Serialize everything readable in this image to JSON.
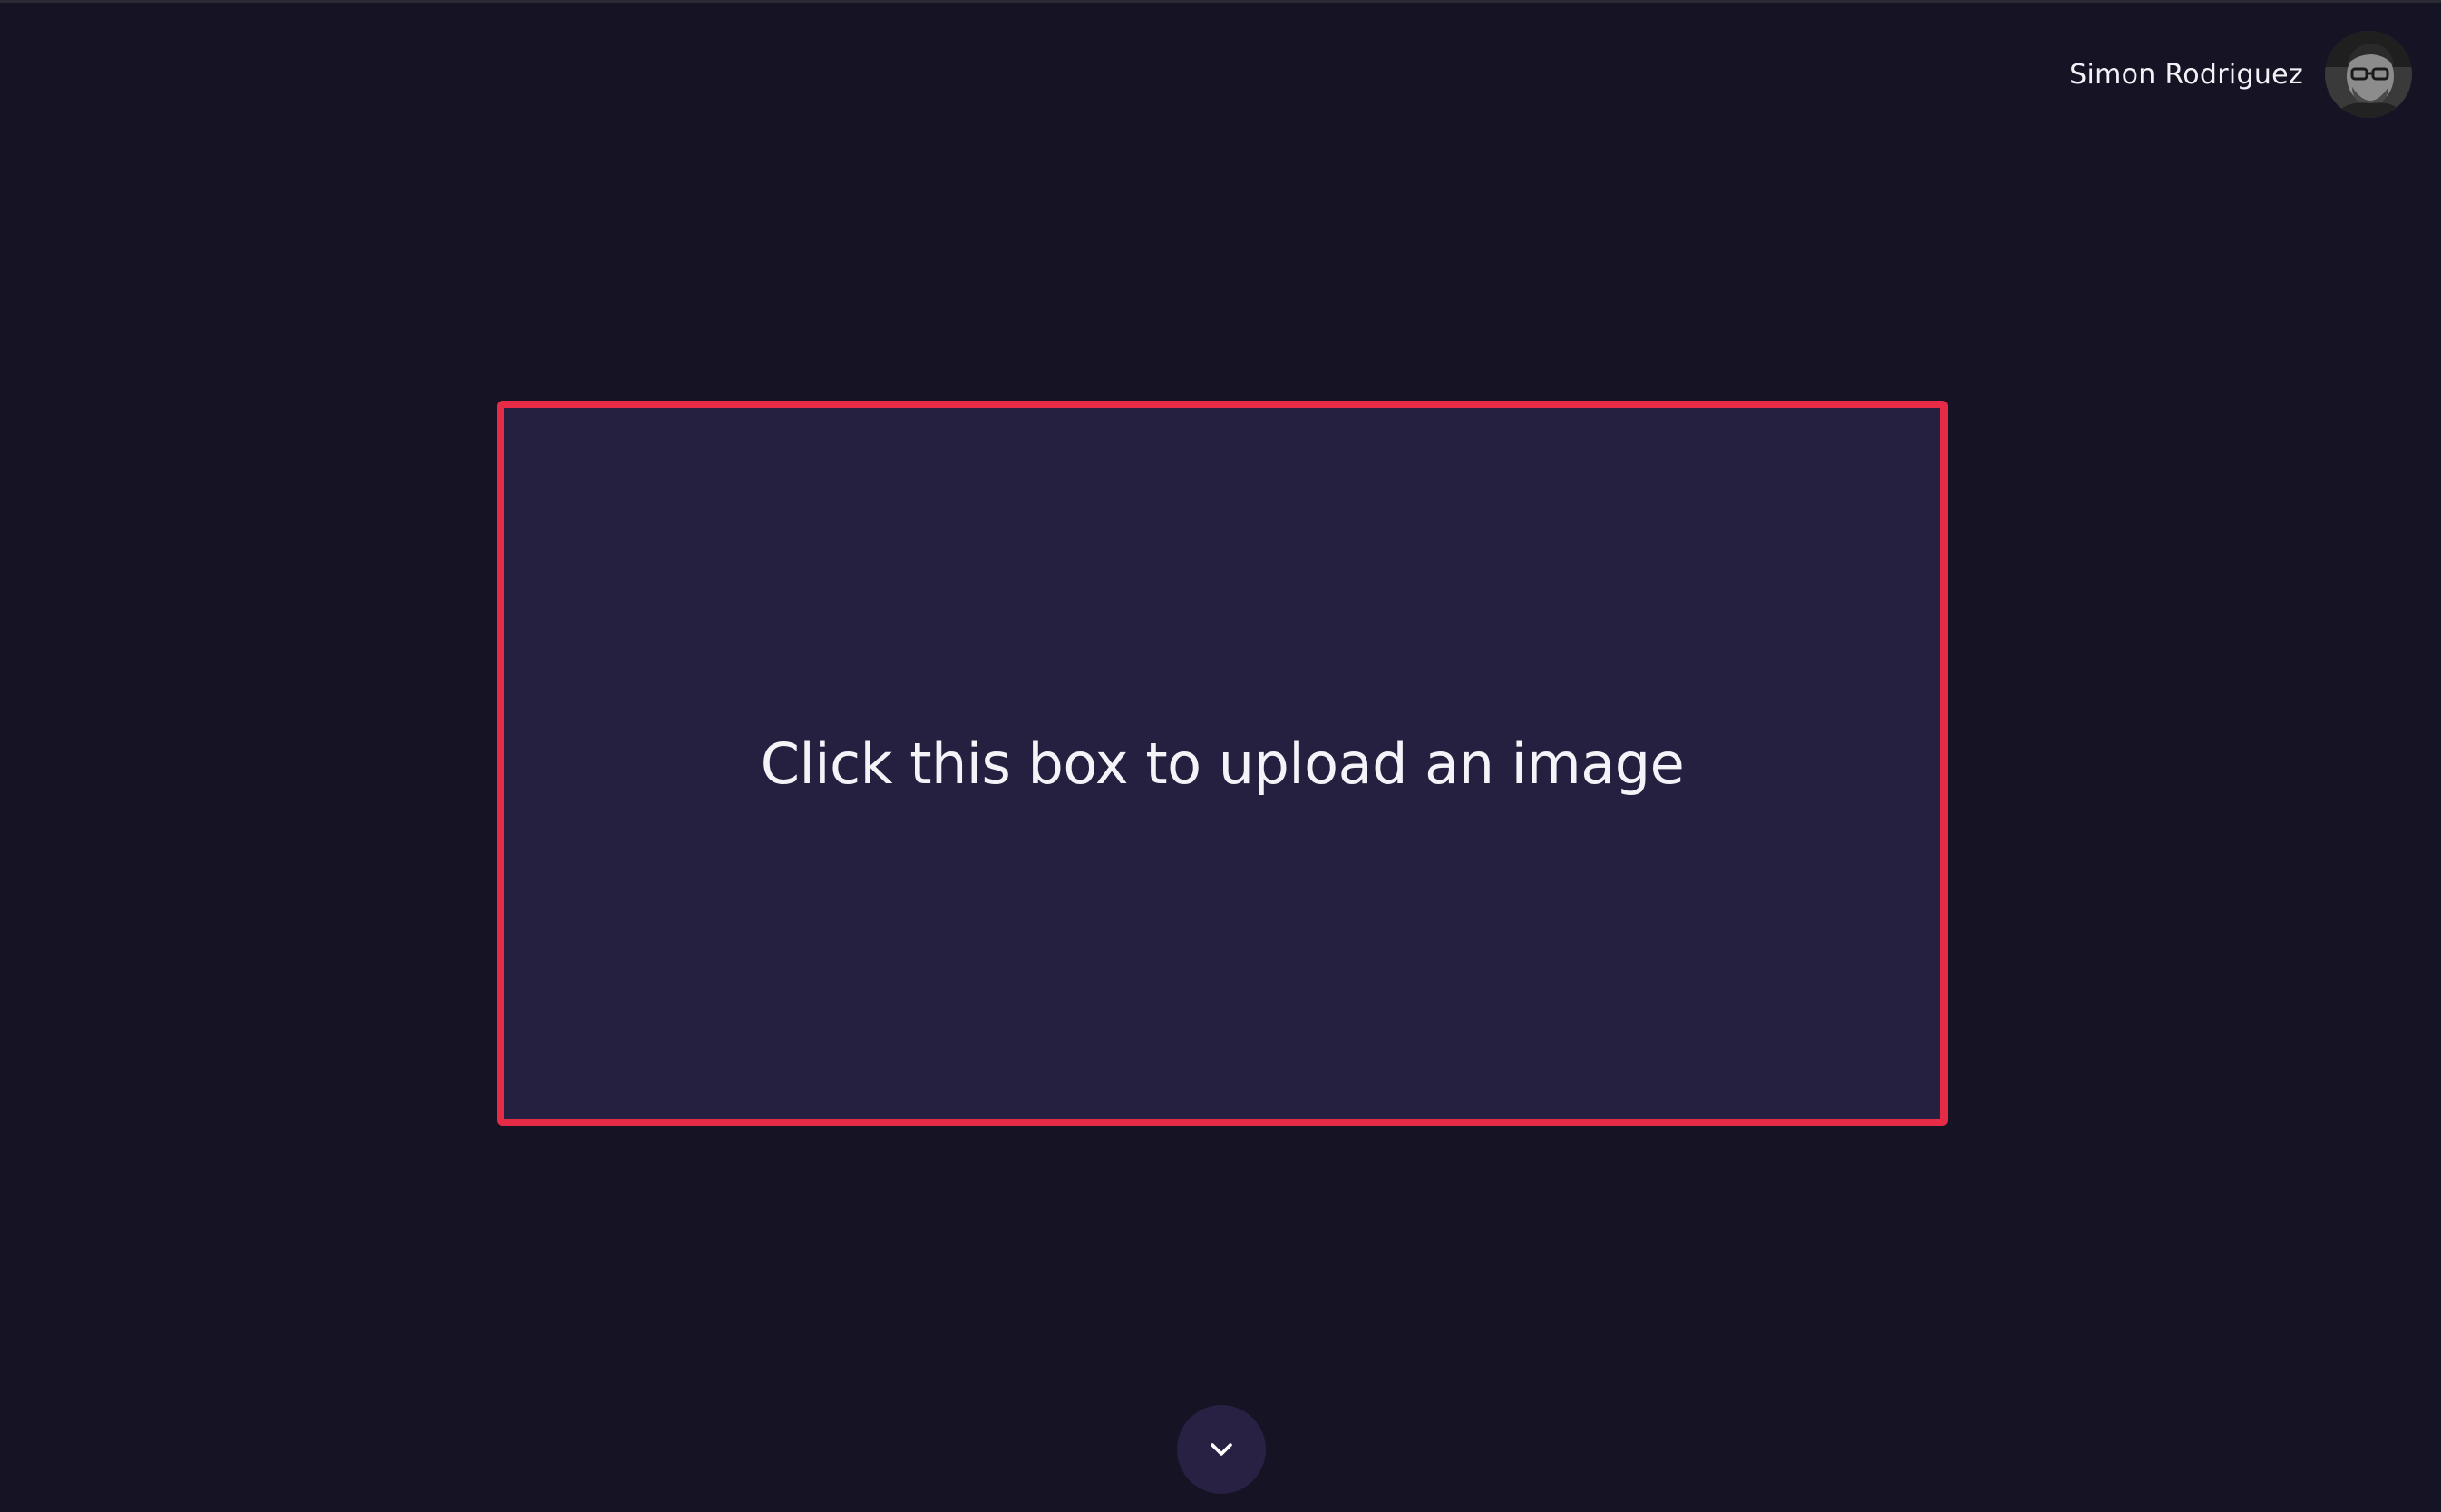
{
  "header": {
    "user_name": "Simon Rodriguez",
    "avatar_icon": "user-avatar-photo"
  },
  "upload": {
    "prompt": "Click this box to upload an image",
    "border_color": "#e52b45",
    "background_color": "#251f40"
  },
  "scroll": {
    "icon": "chevron-down-icon"
  },
  "theme": {
    "page_background": "#161325",
    "text_color": "#f4f3f8"
  }
}
